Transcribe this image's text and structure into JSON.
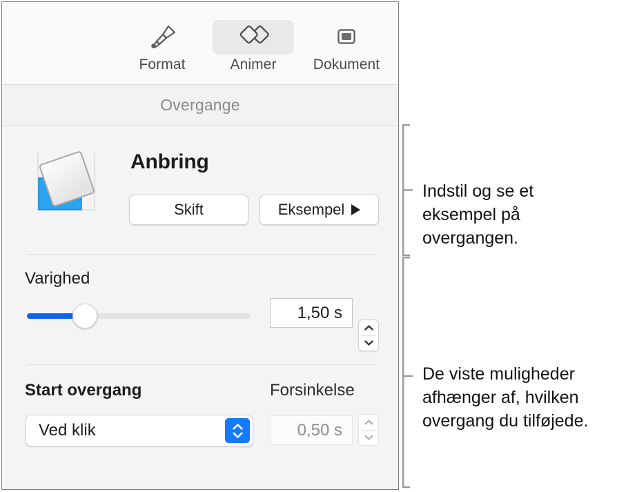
{
  "panel": {
    "toolbar": {
      "tabs": [
        {
          "id": "format",
          "label": "Format",
          "icon": "paintbrush-icon",
          "selected": false
        },
        {
          "id": "animer",
          "label": "Animer",
          "icon": "animate-diamonds-icon",
          "selected": true
        },
        {
          "id": "dokument",
          "label": "Dokument",
          "icon": "document-icon",
          "selected": false
        }
      ]
    },
    "section_header": "Overgange",
    "effect": {
      "thumbnail_icon": "transition-place-thumbnail",
      "name": "Anbring",
      "change_button": "Skift",
      "preview_button": "Eksempel",
      "preview_icon": "play-triangle-icon"
    },
    "duration": {
      "label": "Varighed",
      "slider": {
        "value_fraction": 0.26,
        "min_fraction": 0,
        "max_fraction": 1
      },
      "value": "1,50 s",
      "stepper_icon": "stepper-up-down-icon"
    },
    "start": {
      "label": "Start overgang",
      "popup_value": "Ved klik",
      "popup_icon": "popup-updown-chevrons-icon",
      "delay_label": "Forsinkelse",
      "delay_value": "0,50 s",
      "delay_enabled": false,
      "stepper_icon": "stepper-up-down-icon"
    }
  },
  "callouts": [
    {
      "id": "callout-1",
      "text": "Indstil og se et\neksempel på\novergangen."
    },
    {
      "id": "callout-2",
      "text": "De viste muligheder\nafhænger af, hvilken\novergang du tilføjede."
    }
  ],
  "colors": {
    "accent_blue": "#157aff",
    "slider_blue": "#0a64f0",
    "thumbnail_blue": "#2aa3f0",
    "panel_bg": "#f4f4f4",
    "toolbar_bg": "#fafafa"
  }
}
